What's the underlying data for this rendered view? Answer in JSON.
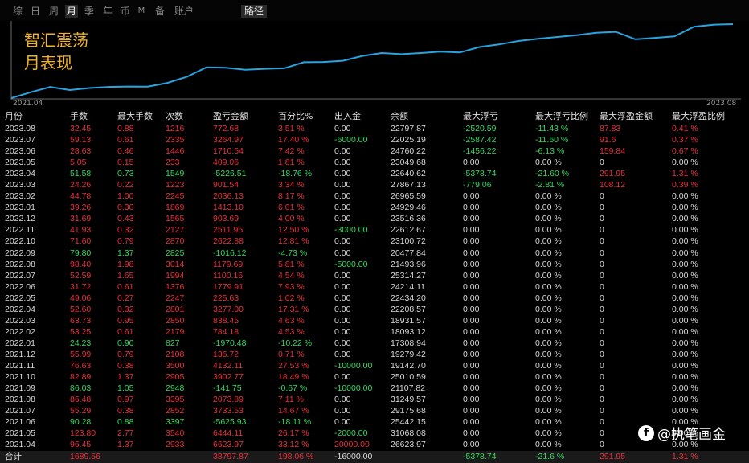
{
  "tabs": [
    "综",
    "日",
    "周",
    "月",
    "季",
    "年",
    "币",
    "M",
    "备",
    "账户"
  ],
  "active_tab": "月",
  "path_tab": "路径",
  "overlay": {
    "line1": "智汇震荡",
    "line2": "月表现"
  },
  "axis": {
    "start": "2021.04",
    "end": "2023.08"
  },
  "colors": {
    "line": "#29a3e0",
    "red": "#e8303a",
    "green": "#35d860",
    "title": "#f0b429"
  },
  "columns": [
    "月份",
    "手数",
    "最大手数",
    "次数",
    "盈亏金额",
    "百分比%",
    "出入金",
    "余额",
    "最大浮亏",
    "最大浮亏比例",
    "最大浮盈金额",
    "最大浮盈比例"
  ],
  "rows": [
    [
      "2023.08",
      "32.45",
      "0.88",
      "1216",
      "772.68",
      "3.51 %",
      "0.00",
      "22797.87",
      "-2520.59",
      "-11.43 %",
      "87.83",
      "0.41 %"
    ],
    [
      "2023.07",
      "59.13",
      "0.61",
      "2335",
      "3264.97",
      "17.40 %",
      "-6000.00",
      "22025.19",
      "-2587.42",
      "-11.60 %",
      "91.6",
      "0.37 %"
    ],
    [
      "2023.06",
      "28.63",
      "0.46",
      "1446",
      "1710.54",
      "7.42 %",
      "0.00",
      "24760.22",
      "-1456.22",
      "-6.13 %",
      "159.84",
      "0.67 %"
    ],
    [
      "2023.05",
      "5.05",
      "0.15",
      "233",
      "409.06",
      "1.81 %",
      "0.00",
      "23049.68",
      "0.00",
      "0.00 %",
      "0",
      "0.00 %"
    ],
    [
      "2023.04",
      "51.58",
      "0.73",
      "1549",
      "-5226.51",
      "-18.76 %",
      "0.00",
      "22640.62",
      "-5378.74",
      "-21.60 %",
      "291.95",
      "1.31 %"
    ],
    [
      "2023.03",
      "24.26",
      "0.22",
      "1223",
      "901.54",
      "3.34 %",
      "0.00",
      "27867.13",
      "-779.06",
      "-2.81 %",
      "108.12",
      "0.39 %"
    ],
    [
      "2023.02",
      "44.78",
      "1.00",
      "2245",
      "2036.13",
      "8.17 %",
      "0.00",
      "26965.59",
      "0.00",
      "0.00 %",
      "0",
      "0.00 %"
    ],
    [
      "2023.01",
      "39.26",
      "0.30",
      "1869",
      "1413.10",
      "6.01 %",
      "0.00",
      "24929.46",
      "0.00",
      "0.00 %",
      "0",
      "0.00 %"
    ],
    [
      "2022.12",
      "31.69",
      "0.43",
      "1565",
      "903.69",
      "4.00 %",
      "0.00",
      "23516.36",
      "0.00",
      "0.00 %",
      "0",
      "0.00 %"
    ],
    [
      "2022.11",
      "41.93",
      "0.32",
      "2127",
      "2511.95",
      "12.50 %",
      "-3000.00",
      "22612.67",
      "0.00",
      "0.00 %",
      "0",
      "0.00 %"
    ],
    [
      "2022.10",
      "71.60",
      "0.79",
      "2870",
      "2622.88",
      "12.81 %",
      "0.00",
      "23100.72",
      "0.00",
      "0.00 %",
      "0",
      "0.00 %"
    ],
    [
      "2022.09",
      "79.80",
      "1.37",
      "2825",
      "-1016.12",
      "-4.73 %",
      "0.00",
      "20477.84",
      "0.00",
      "0.00 %",
      "0",
      "0.00 %"
    ],
    [
      "2022.08",
      "98.40",
      "1.98",
      "3014",
      "1179.69",
      "5.81 %",
      "-5000.00",
      "21493.96",
      "0.00",
      "0.00 %",
      "0",
      "0.00 %"
    ],
    [
      "2022.07",
      "52.59",
      "1.65",
      "1994",
      "1100.16",
      "4.54 %",
      "0.00",
      "25314.27",
      "0.00",
      "0.00 %",
      "0",
      "0.00 %"
    ],
    [
      "2022.06",
      "31.72",
      "0.61",
      "1376",
      "1779.91",
      "7.93 %",
      "0.00",
      "24214.11",
      "0.00",
      "0.00 %",
      "0",
      "0.00 %"
    ],
    [
      "2022.05",
      "49.06",
      "0.27",
      "2247",
      "225.63",
      "1.02 %",
      "0.00",
      "22434.20",
      "0.00",
      "0.00 %",
      "0",
      "0.00 %"
    ],
    [
      "2022.04",
      "52.60",
      "0.32",
      "2801",
      "3277.00",
      "17.31 %",
      "0.00",
      "22208.57",
      "0.00",
      "0.00 %",
      "0",
      "0.00 %"
    ],
    [
      "2022.03",
      "63.73",
      "0.95",
      "2850",
      "838.45",
      "4.63 %",
      "0.00",
      "18931.57",
      "0.00",
      "0.00 %",
      "0",
      "0.00 %"
    ],
    [
      "2022.02",
      "53.25",
      "0.61",
      "2179",
      "784.18",
      "4.53 %",
      "0.00",
      "18093.12",
      "0.00",
      "0.00 %",
      "0",
      "0.00 %"
    ],
    [
      "2022.01",
      "24.23",
      "0.90",
      "827",
      "-1970.48",
      "-10.22 %",
      "0.00",
      "17308.94",
      "0.00",
      "0.00 %",
      "0",
      "0.00 %"
    ],
    [
      "2021.12",
      "55.99",
      "0.79",
      "2108",
      "136.72",
      "0.71 %",
      "0.00",
      "19279.42",
      "0.00",
      "0.00 %",
      "0",
      "0.00 %"
    ],
    [
      "2021.11",
      "76.63",
      "0.38",
      "3500",
      "4132.11",
      "27.53 %",
      "-10000.00",
      "19142.70",
      "0.00",
      "0.00 %",
      "0",
      "0.00 %"
    ],
    [
      "2021.10",
      "82.89",
      "1.37",
      "2905",
      "3902.77",
      "18.49 %",
      "0.00",
      "25010.59",
      "0.00",
      "0.00 %",
      "0",
      "0.00 %"
    ],
    [
      "2021.09",
      "86.03",
      "1.05",
      "2948",
      "-141.75",
      "-0.67 %",
      "-10000.00",
      "21107.82",
      "0.00",
      "0.00 %",
      "0",
      "0.00 %"
    ],
    [
      "2021.08",
      "86.48",
      "0.97",
      "3395",
      "2073.89",
      "7.11 %",
      "0.00",
      "31249.57",
      "0.00",
      "0.00 %",
      "0",
      "0.00 %"
    ],
    [
      "2021.07",
      "55.29",
      "0.38",
      "2852",
      "3733.53",
      "14.67 %",
      "0.00",
      "29175.68",
      "0.00",
      "0.00 %",
      "0",
      "0.00 %"
    ],
    [
      "2021.06",
      "90.28",
      "0.88",
      "3397",
      "-5625.93",
      "-18.11 %",
      "0.00",
      "25442.15",
      "0.00",
      "0.00 %",
      "0",
      "0.00 %"
    ],
    [
      "2021.05",
      "123.80",
      "2.77",
      "3540",
      "6444.11",
      "26.17 %",
      "-2000.00",
      "31068.08",
      "0.00",
      "0.00 %",
      "0",
      "0.00 %"
    ],
    [
      "2021.04",
      "96.45",
      "1.37",
      "2933",
      "6623.97",
      "33.12 %",
      "20000.00",
      "26623.97",
      "0.00",
      "0.00 %",
      "0",
      "0.00 %"
    ]
  ],
  "total": [
    "合计",
    "1689.56",
    "",
    "",
    "38797.87",
    "198.06 %",
    "-16000.00",
    "",
    "-5378.74",
    "-21.6 %",
    "291.95",
    "1.31 %"
  ],
  "curve_values": [
    0,
    2046,
    3900,
    2800,
    3500,
    3900,
    4050,
    4000,
    5300,
    7400,
    10700,
    10600,
    9900,
    10200,
    10400,
    12500,
    12600,
    13000,
    14700,
    15700,
    15300,
    15700,
    16200,
    15900,
    17800,
    18700,
    19900,
    20700,
    21300,
    21950,
    22800,
    23100,
    20500,
    21000,
    21500,
    24900,
    25600,
    25800
  ],
  "watermark": "@执笔画金"
}
